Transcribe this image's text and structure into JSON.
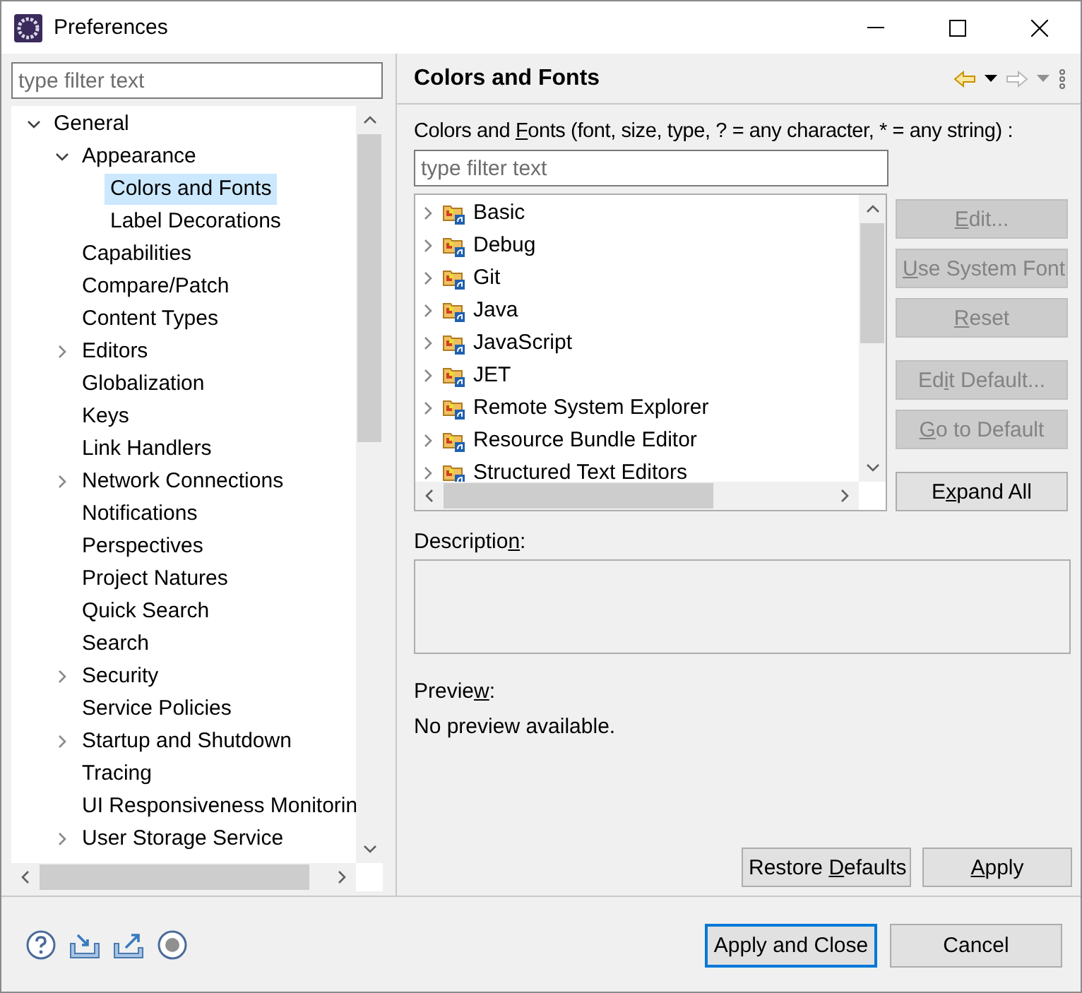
{
  "window": {
    "title": "Preferences"
  },
  "sidebar": {
    "filter": {
      "placeholder": "type filter text"
    },
    "tree": [
      {
        "label": "General",
        "expanded": true,
        "selected": false,
        "children": [
          {
            "label": "Appearance",
            "expanded": true,
            "selected": false,
            "children": [
              {
                "label": "Colors and Fonts",
                "selected": true
              },
              {
                "label": "Label Decorations",
                "selected": false
              }
            ]
          },
          {
            "label": "Capabilities",
            "selected": false
          },
          {
            "label": "Compare/Patch",
            "selected": false
          },
          {
            "label": "Content Types",
            "selected": false
          },
          {
            "label": "Editors",
            "expanded": false,
            "selected": false
          },
          {
            "label": "Globalization",
            "selected": false
          },
          {
            "label": "Keys",
            "selected": false
          },
          {
            "label": "Link Handlers",
            "selected": false
          },
          {
            "label": "Network Connections",
            "expanded": false,
            "selected": false
          },
          {
            "label": "Notifications",
            "selected": false
          },
          {
            "label": "Perspectives",
            "selected": false
          },
          {
            "label": "Project Natures",
            "selected": false
          },
          {
            "label": "Quick Search",
            "selected": false
          },
          {
            "label": "Search",
            "selected": false
          },
          {
            "label": "Security",
            "expanded": false,
            "selected": false
          },
          {
            "label": "Service Policies",
            "selected": false
          },
          {
            "label": "Startup and Shutdown",
            "expanded": false,
            "selected": false
          },
          {
            "label": "Tracing",
            "selected": false
          },
          {
            "label": "UI Responsiveness Monitorin",
            "selected": false
          },
          {
            "label": "User Storage Service",
            "expanded": false,
            "selected": false
          }
        ]
      }
    ]
  },
  "page": {
    "title": "Colors and Fonts",
    "filter_label": {
      "pre": "Colors and ",
      "key": "F",
      "post": "onts (font, size, type, ? = any character, * = any string) :"
    },
    "filter": {
      "placeholder": "type filter text"
    },
    "categories": [
      {
        "label": "Basic"
      },
      {
        "label": "Debug"
      },
      {
        "label": "Git"
      },
      {
        "label": "Java"
      },
      {
        "label": "JavaScript"
      },
      {
        "label": "JET"
      },
      {
        "label": "Remote System Explorer"
      },
      {
        "label": "Resource Bundle Editor"
      },
      {
        "label": "Structured Text Editors"
      }
    ],
    "button_groups": [
      [
        {
          "label": {
            "key": "E",
            "post": "dit..."
          },
          "disabled": true
        },
        {
          "label": {
            "key": "U",
            "post": "se System Font"
          },
          "disabled": true
        },
        {
          "label": {
            "key": "R",
            "post": "eset"
          },
          "disabled": true
        }
      ],
      [
        {
          "label": {
            "pre": "Ed",
            "key": "i",
            "post": "t Default..."
          },
          "disabled": true
        },
        {
          "label": {
            "key": "G",
            "post": "o to Default"
          },
          "disabled": true
        }
      ],
      [
        {
          "label": {
            "pre": "E",
            "key": "x",
            "post": "pand All"
          },
          "disabled": false
        }
      ]
    ],
    "description": {
      "label": {
        "pre": "Descriptio",
        "key": "n",
        "post": ":"
      }
    },
    "preview": {
      "label": {
        "pre": "Previe",
        "key": "w",
        "post": ":"
      },
      "text": "No preview available."
    },
    "buttons": [
      {
        "label": {
          "pre": "Restore ",
          "key": "D",
          "post": "efaults"
        }
      },
      {
        "label": {
          "key": "A",
          "post": "pply"
        }
      }
    ]
  },
  "footer": {
    "buttons": [
      {
        "label": "Apply and Close",
        "default": true
      },
      {
        "label": "Cancel",
        "default": false
      }
    ]
  }
}
